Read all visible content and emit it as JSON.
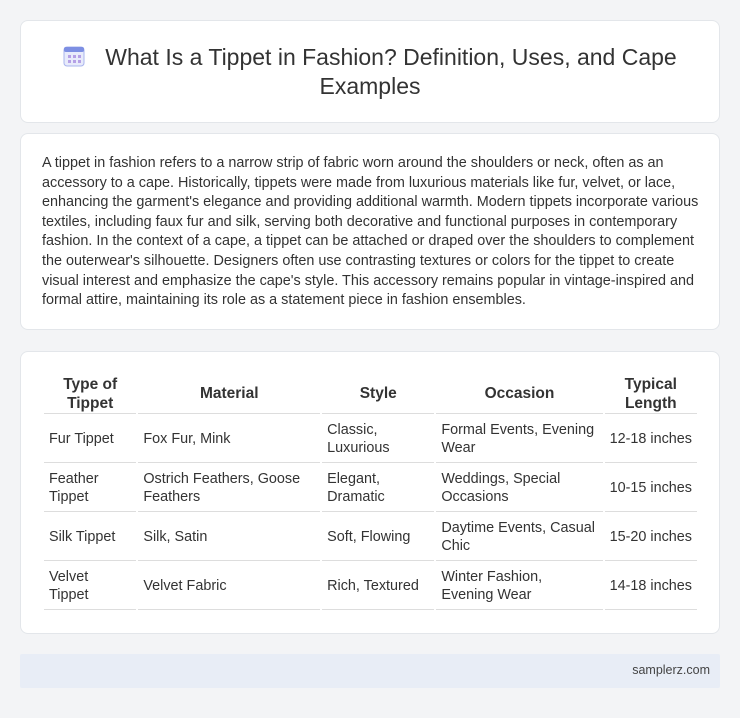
{
  "page": {
    "title": "What Is a Tippet in Fashion? Definition, Uses, and Cape Examples",
    "title_icon": "calendar-icon",
    "accent_color": "#7d8fe3"
  },
  "description": "A tippet in fashion refers to a narrow strip of fabric worn around the shoulders or neck, often as an accessory to a cape. Historically, tippets were made from luxurious materials like fur, velvet, or lace, enhancing the garment's elegance and providing additional warmth. Modern tippets incorporate various textiles, including faux fur and silk, serving both decorative and functional purposes in contemporary fashion. In the context of a cape, a tippet can be attached or draped over the shoulders to complement the outerwear's silhouette. Designers often use contrasting textures or colors for the tippet to create visual interest and emphasize the cape's style. This accessory remains popular in vintage-inspired and formal attire, maintaining its role as a statement piece in fashion ensembles.",
  "table": {
    "headers": [
      "Type of Tippet",
      "Material",
      "Style",
      "Occasion",
      "Typical Length"
    ],
    "rows": [
      [
        "Fur Tippet",
        "Fox Fur, Mink",
        "Classic, Luxurious",
        "Formal Events, Evening Wear",
        "12-18 inches"
      ],
      [
        "Feather Tippet",
        "Ostrich Feathers, Goose Feathers",
        "Elegant, Dramatic",
        "Weddings, Special Occasions",
        "10-15 inches"
      ],
      [
        "Silk Tippet",
        "Silk, Satin",
        "Soft, Flowing",
        "Daytime Events, Casual Chic",
        "15-20 inches"
      ],
      [
        "Velvet Tippet",
        "Velvet Fabric",
        "Rich, Textured",
        "Winter Fashion, Evening Wear",
        "14-18 inches"
      ]
    ]
  },
  "footer": {
    "source": "samplerz.com"
  }
}
